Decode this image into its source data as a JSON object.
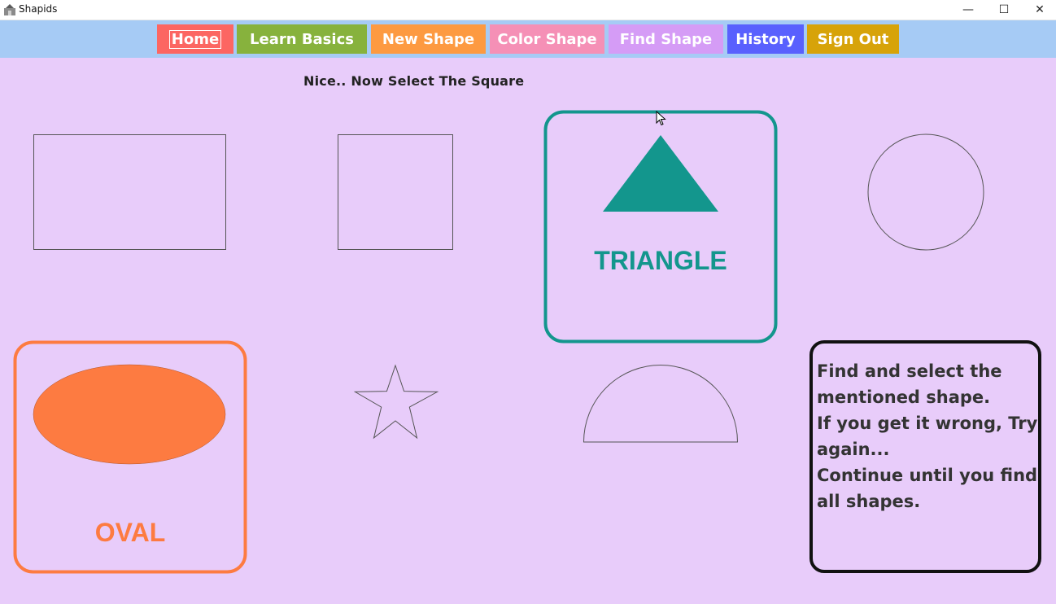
{
  "window": {
    "title": "Shapids",
    "minimize_glyph": "—",
    "maximize_glyph": "☐",
    "close_glyph": "✕"
  },
  "nav": {
    "items": [
      {
        "label": "Home",
        "color": "#fc6662"
      },
      {
        "label": "Learn Basics",
        "color": "#87b23d"
      },
      {
        "label": "New Shape",
        "color": "#fd9a41"
      },
      {
        "label": "Color Shape",
        "color": "#f590b6"
      },
      {
        "label": "Find Shape",
        "color": "#d59cf6"
      },
      {
        "label": "History",
        "color": "#5960fe"
      },
      {
        "label": "Sign Out",
        "color": "#d7a309"
      }
    ]
  },
  "instruction": "Nice.. Now Select The Square",
  "shapes": {
    "outline_color": "#555555",
    "triangle": {
      "label": "TRIANGLE",
      "color": "#13968d",
      "selected": true
    },
    "oval": {
      "label": "OVAL",
      "color": "#fd7b41",
      "selected": true
    },
    "rectangle": {
      "selected": false
    },
    "square": {
      "selected": false
    },
    "circle": {
      "selected": false
    },
    "star": {
      "selected": false
    },
    "semicircle": {
      "selected": false
    }
  },
  "help": {
    "text": "Find and select the mentioned shape.\nIf you get it wrong, Try again...\nContinue until you find all shapes."
  }
}
